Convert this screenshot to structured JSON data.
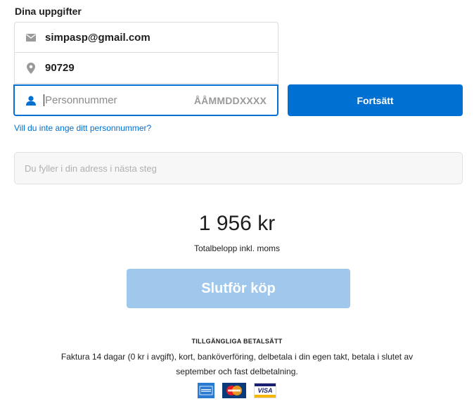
{
  "form": {
    "title": "Dina uppgifter",
    "email": "simpasp@gmail.com",
    "zip": "90729",
    "pnr_placeholder": "Personnummer",
    "pnr_value": "",
    "pnr_format": "ÅÅMMDDXXXX",
    "continue_label": "Fortsätt",
    "no_pnr_link": "Vill du inte ange ditt personnummer?"
  },
  "address": {
    "placeholder": "Du fyller i din adress i nästa steg"
  },
  "summary": {
    "total": "1 956 kr",
    "total_label": "Totalbelopp inkl. moms",
    "complete_label": "Slutför köp"
  },
  "payment": {
    "title": "TILLGÄNGLIGA BETALSÄTT",
    "description": "Faktura 14 dagar (0 kr i avgift), kort, banköverföring, delbetala i din egen takt, betala i slutet av september och fast delbetalning.",
    "cards": [
      "American Express",
      "MasterCard",
      "VISA"
    ]
  },
  "colors": {
    "accent": "#0070d2",
    "disabled_button": "#9fc8ec",
    "icon_gray": "#9a9a9a"
  }
}
